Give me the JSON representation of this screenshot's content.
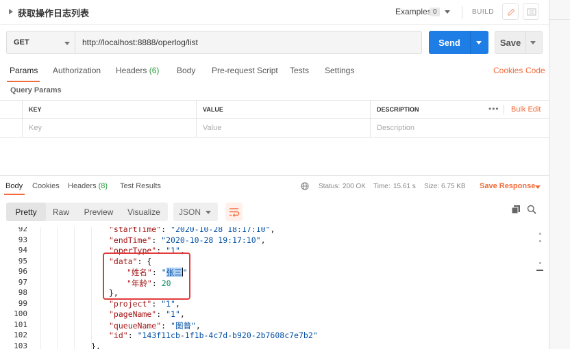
{
  "header": {
    "request_title": "获取操作日志列表",
    "examples_label": "Examples",
    "examples_count": "0",
    "build_label": "BUILD",
    "icons": [
      "pencil-icon",
      "comment-icon"
    ]
  },
  "urlbar": {
    "method": "GET",
    "url": "http://localhost:8888/operlog/list",
    "send_label": "Send",
    "save_label": "Save"
  },
  "request_tabs": {
    "params": "Params",
    "authorization": "Authorization",
    "headers": "Headers",
    "headers_count": "(6)",
    "body": "Body",
    "prerequest": "Pre-request Script",
    "tests": "Tests",
    "settings": "Settings",
    "cookies": "Cookies",
    "code": "Code"
  },
  "params": {
    "section_title": "Query Params",
    "columns": [
      "KEY",
      "VALUE",
      "DESCRIPTION"
    ],
    "more_label": "•••",
    "bulk_edit": "Bulk Edit",
    "placeholders": [
      "Key",
      "Value",
      "Description"
    ]
  },
  "response": {
    "tabs": {
      "body": "Body",
      "cookies": "Cookies",
      "headers": "Headers",
      "headers_count": "(8)",
      "test_results": "Test Results"
    },
    "status_label": "Status:",
    "status_value": "200 OK",
    "time_label": "Time:",
    "time_value": "15.61 s",
    "size_label": "Size:",
    "size_value": "6.75 KB",
    "save_response": "Save Response",
    "format_buttons": [
      "Pretty",
      "Raw",
      "Preview",
      "Visualize"
    ],
    "format_active": "Pretty",
    "language": "JSON"
  },
  "code": {
    "lines": [
      {
        "n": "92",
        "key": "startTime",
        "val": "2020-10-28 18:17:10",
        "type": "string",
        "comma": true
      },
      {
        "n": "93",
        "key": "endTime",
        "val": "2020-10-28 19:17:10",
        "type": "string",
        "comma": true
      },
      {
        "n": "94",
        "key": "operType",
        "val": "1",
        "type": "string",
        "comma": true
      },
      {
        "n": "95",
        "key": "data",
        "val": "{",
        "type": "open"
      },
      {
        "n": "96",
        "key": "姓名",
        "val": "张三",
        "type": "string",
        "comma": true
      },
      {
        "n": "97",
        "key": "年龄",
        "val": "20",
        "type": "number"
      },
      {
        "n": "98",
        "val": "},",
        "type": "close"
      },
      {
        "n": "99",
        "key": "project",
        "val": "1",
        "type": "string",
        "comma": true
      },
      {
        "n": "100",
        "key": "pageName",
        "val": "1",
        "type": "string",
        "comma": true
      },
      {
        "n": "101",
        "key": "queueName",
        "val": "图普",
        "type": "string",
        "comma": true
      },
      {
        "n": "102",
        "key": "id",
        "val": "143f11cb-1f1b-4c7d-b920-2b7608c7e7b2",
        "type": "string"
      },
      {
        "n": "103",
        "val": "},",
        "type": "close"
      }
    ]
  },
  "colors": {
    "accent_orange": "#f26b3a",
    "send_blue": "#1f7de6",
    "status_green": "#2b9a3c",
    "highlight_red": "#e23a3a"
  }
}
